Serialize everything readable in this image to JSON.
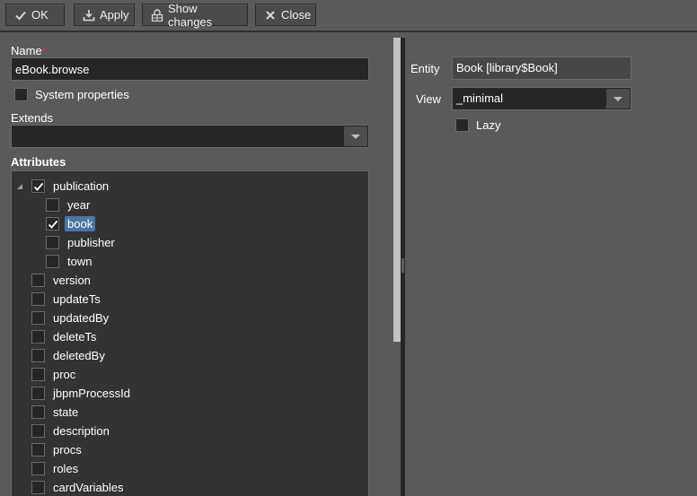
{
  "toolbar": {
    "buttons": [
      {
        "id": "ok",
        "label": "OK",
        "icon": "check-icon"
      },
      {
        "id": "apply",
        "label": "Apply",
        "icon": "download-icon"
      },
      {
        "id": "show_changes",
        "label": "Show changes",
        "icon": "lock-changes-icon"
      },
      {
        "id": "close",
        "label": "Close",
        "icon": "close-icon"
      }
    ]
  },
  "form": {
    "name_label": "Name",
    "name_required_mark": "*",
    "name_value": "eBook.browse",
    "system_properties_label": "System properties",
    "system_properties_checked": false,
    "extends_label": "Extends",
    "extends_value": "",
    "attributes_label": "Attributes"
  },
  "attributes": [
    {
      "label": "publication",
      "checked": true,
      "level": 0,
      "expanded": true
    },
    {
      "label": "year",
      "checked": false,
      "level": 1
    },
    {
      "label": "book",
      "checked": true,
      "level": 1,
      "selected": true
    },
    {
      "label": "publisher",
      "checked": false,
      "level": 1
    },
    {
      "label": "town",
      "checked": false,
      "level": 1
    },
    {
      "label": "version",
      "checked": false,
      "level": 0
    },
    {
      "label": "updateTs",
      "checked": false,
      "level": 0
    },
    {
      "label": "updatedBy",
      "checked": false,
      "level": 0
    },
    {
      "label": "deleteTs",
      "checked": false,
      "level": 0
    },
    {
      "label": "deletedBy",
      "checked": false,
      "level": 0
    },
    {
      "label": "proc",
      "checked": false,
      "level": 0
    },
    {
      "label": "jbpmProcessId",
      "checked": false,
      "level": 0
    },
    {
      "label": "state",
      "checked": false,
      "level": 0
    },
    {
      "label": "description",
      "checked": false,
      "level": 0
    },
    {
      "label": "procs",
      "checked": false,
      "level": 0
    },
    {
      "label": "roles",
      "checked": false,
      "level": 0
    },
    {
      "label": "cardVariables",
      "checked": false,
      "level": 0
    }
  ],
  "details": {
    "entity_label": "Entity",
    "entity_value": "Book [library$Book]",
    "view_label": "View",
    "view_value": "_minimal",
    "lazy_label": "Lazy",
    "lazy_checked": false
  }
}
